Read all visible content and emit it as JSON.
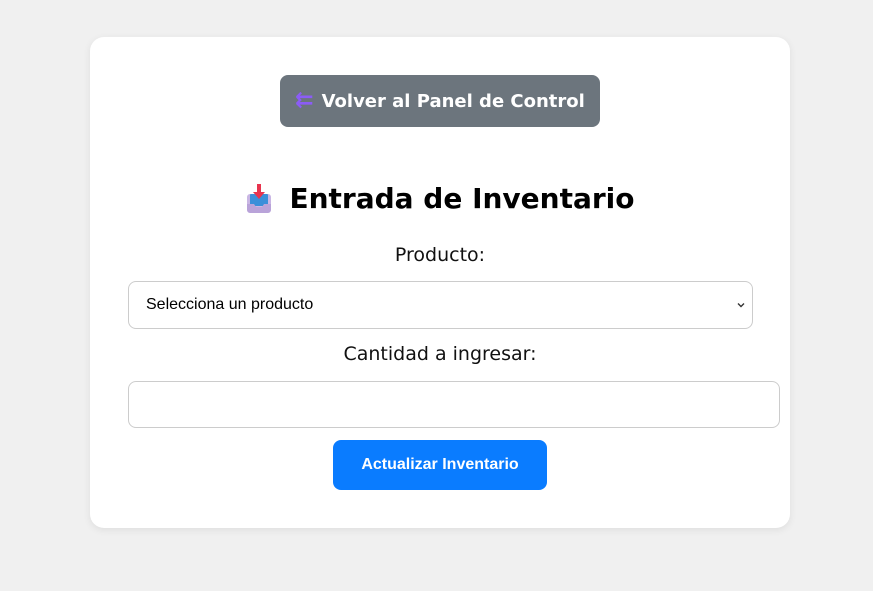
{
  "back_button": {
    "label": "Volver al Panel de Control",
    "icon": "left-right-arrows-icon",
    "icon_glyph": "⇇",
    "bg_color": "#6c757d",
    "icon_color": "#8b5cf6"
  },
  "page": {
    "title": "Entrada de Inventario",
    "title_icon": "inbox-tray-icon"
  },
  "form": {
    "product_label": "Producto:",
    "product_select_value": "Selecciona un producto",
    "quantity_label": "Cantidad a ingresar:",
    "quantity_value": "",
    "submit_label": "Actualizar Inventario",
    "submit_color": "#0a7cff"
  }
}
